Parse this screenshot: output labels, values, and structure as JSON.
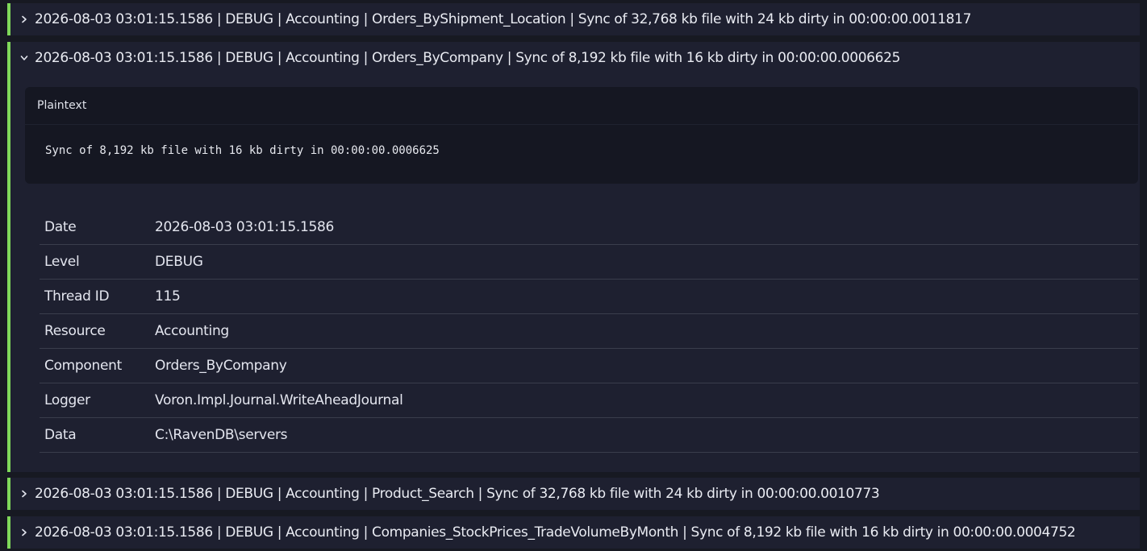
{
  "entries": [
    {
      "summary": "2026-08-03 03:01:15.1586 | DEBUG | Accounting | Orders_ByShipment_Location | Sync of 32,768 kb file with 24 kb dirty in 00:00:00.0011817",
      "expanded": false
    },
    {
      "summary": "2026-08-03 03:01:15.1586 | DEBUG | Accounting | Orders_ByCompany | Sync of 8,192 kb file with 16 kb dirty in 00:00:00.0006625",
      "expanded": true,
      "plaintext": {
        "title": "Plaintext",
        "body": "Sync of 8,192 kb file with 16 kb dirty in 00:00:00.0006625"
      },
      "details": [
        {
          "key": "Date",
          "value": "2026-08-03 03:01:15.1586"
        },
        {
          "key": "Level",
          "value": "DEBUG"
        },
        {
          "key": "Thread ID",
          "value": "115"
        },
        {
          "key": "Resource",
          "value": "Accounting"
        },
        {
          "key": "Component",
          "value": "Orders_ByCompany"
        },
        {
          "key": "Logger",
          "value": "Voron.Impl.Journal.WriteAheadJournal"
        },
        {
          "key": "Data",
          "value": "C:\\RavenDB\\servers"
        }
      ]
    },
    {
      "summary": "2026-08-03 03:01:15.1586 | DEBUG | Accounting | Product_Search | Sync of 32,768 kb file with 24 kb dirty in 00:00:00.0010773",
      "expanded": false
    },
    {
      "summary": "2026-08-03 03:01:15.1586 | DEBUG | Accounting | Companies_StockPrices_TradeVolumeByMonth | Sync of 8,192 kb file with 16 kb dirty in 00:00:00.0004752",
      "expanded": false
    }
  ],
  "colors": {
    "background": "#171922",
    "entry_background": "#1e2030",
    "level_accent": "#7fd85a",
    "panel_background": "#151722",
    "divider": "#3a3d4c"
  },
  "icons": {
    "collapsed": "chevron-right-icon",
    "expanded": "chevron-down-icon"
  }
}
